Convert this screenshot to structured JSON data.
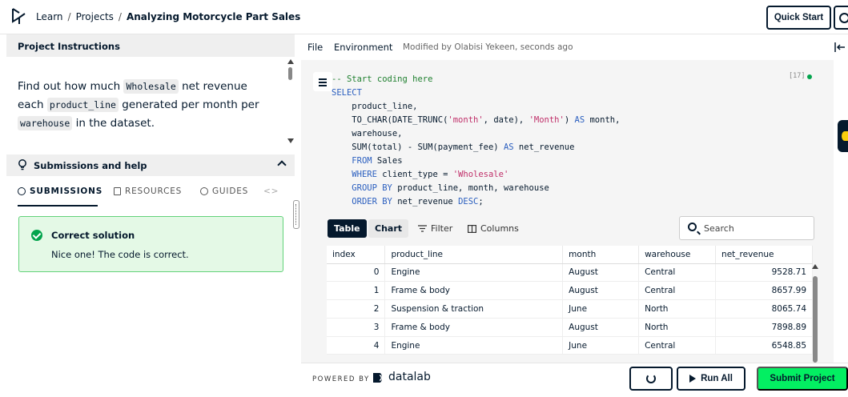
{
  "breadcrumb": {
    "learn": "Learn",
    "projects": "Projects",
    "current": "Analyzing Motorcycle Part Sales",
    "sep": "/"
  },
  "header": {
    "quick_start": "Quick Start"
  },
  "instructions": {
    "title": "Project Instructions",
    "t1": "Find out how much",
    "c1": "Wholesale",
    "t2": "net revenue each",
    "c2": "product_line",
    "t3": "generated per month per",
    "c3": "warehouse",
    "t4": "in the dataset."
  },
  "submissions": {
    "title": "Submissions and help",
    "tabs": {
      "submissions": "SUBMISSIONS",
      "resources": "RESOURCES",
      "guides": "GUIDES",
      "more": "<>"
    },
    "result_title": "Correct solution",
    "result_message": "Nice one! The code is correct."
  },
  "menu": {
    "file": "File",
    "environment": "Environment",
    "modified": "Modified by Olabisi Yekeen, seconds ago"
  },
  "editor": {
    "cell_count": "[17]",
    "lines": [
      "-- Start coding here",
      "SELECT",
      "    product_line,",
      "    TO_CHAR(DATE_TRUNC('month', date), 'Month') AS month,",
      "    warehouse,",
      "    SUM(total) - SUM(payment_fee) AS net_revenue",
      "    FROM Sales",
      "    WHERE client_type = 'Wholesale'",
      "    GROUP BY product_line, month, warehouse",
      "    ORDER BY net_revenue DESC;"
    ]
  },
  "results": {
    "toolbar": {
      "table": "Table",
      "chart": "Chart",
      "filter": "Filter",
      "columns": "Columns"
    },
    "search_placeholder": "Search",
    "columns": [
      "index",
      "product_line",
      "month",
      "warehouse",
      "net_revenue"
    ],
    "rows": [
      [
        "0",
        "Engine",
        "August",
        "Central",
        "9528.71"
      ],
      [
        "1",
        "Frame & body",
        "August",
        "Central",
        "8657.99"
      ],
      [
        "2",
        "Suspension & traction",
        "June",
        "North",
        "8065.74"
      ],
      [
        "3",
        "Frame & body",
        "August",
        "North",
        "7898.89"
      ],
      [
        "4",
        "Engine",
        "June",
        "Central",
        "6548.85"
      ]
    ]
  },
  "footer": {
    "powered_by": "POWERED BY",
    "brand": "datalab",
    "run_all": "Run All",
    "submit": "Submit Project"
  },
  "colors": {
    "navy": "#05192d",
    "brand_green": "#03ef62",
    "success_bg": "#e4f9e6",
    "success_border": "#63d27a"
  }
}
